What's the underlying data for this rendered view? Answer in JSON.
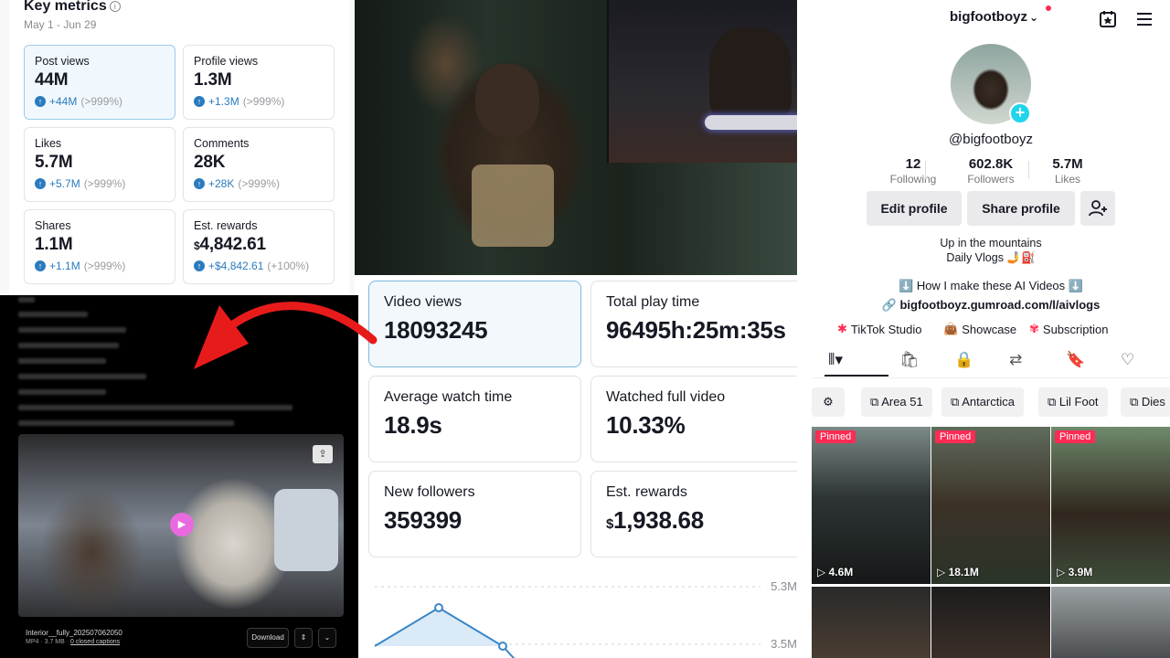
{
  "key_metrics": {
    "title": "Key metrics",
    "info_icon": "info-icon",
    "date_range": "May 1 - Jun 29",
    "cards": [
      {
        "label": "Post views",
        "value": "44M",
        "delta": "+44M",
        "pct": "(>999%)",
        "active": true
      },
      {
        "label": "Profile views",
        "value": "1.3M",
        "delta": "+1.3M",
        "pct": "(>999%)"
      },
      {
        "label": "Likes",
        "value": "5.7M",
        "delta": "+5.7M",
        "pct": "(>999%)"
      },
      {
        "label": "Comments",
        "value": "28K",
        "delta": "+28K",
        "pct": "(>999%)"
      },
      {
        "label": "Shares",
        "value": "1.1M",
        "delta": "+1.1M",
        "pct": "(>999%)"
      },
      {
        "label": "Est. rewards",
        "currency": "$",
        "value": "4,842.61",
        "delta": "+$4,842.61",
        "pct": "(+100%)"
      }
    ]
  },
  "download_panel": {
    "file_name": "Interior__fully_202507062050",
    "file_meta": "MP4 · 3.7 MB · ",
    "captions_link": "0 closed captions",
    "download_label": "Download",
    "accent_color": "#e96ae0"
  },
  "video_stats": {
    "cards": [
      {
        "label": "Video views",
        "value": "18093245",
        "active": true
      },
      {
        "label": "Total play time",
        "value": "96495h:25m:35s"
      },
      {
        "label": "Average watch time",
        "value": "18.9s"
      },
      {
        "label": "Watched full video",
        "value": "10.33%"
      },
      {
        "label": "New followers",
        "value": "359399"
      },
      {
        "label": "Est. rewards",
        "currency": "$",
        "value": "1,938.68"
      }
    ],
    "chart_ticks": [
      "5.3M",
      "3.5M"
    ]
  },
  "profile": {
    "username": "bigfootboyz",
    "handle": "@bigfootboyz",
    "stats": [
      {
        "value": "12",
        "label": "Following"
      },
      {
        "value": "602.8K",
        "label": "Followers"
      },
      {
        "value": "5.7M",
        "label": "Likes"
      }
    ],
    "edit_profile": "Edit profile",
    "share_profile": "Share profile",
    "bio_line1": "Up in the mountains",
    "bio_line2": "Daily Vlogs 🤳⛽",
    "bio_line3": "⬇️ How I make these AI Videos ⬇️",
    "link": "bigfootboyz.gumroad.com/l/aivlogs",
    "tools": [
      "TikTok Studio",
      "Showcase",
      "Subscription"
    ],
    "collections": [
      "Area 51",
      "Antarctica",
      "Lil Foot",
      "Dies"
    ],
    "pinned_label": "Pinned",
    "videos": [
      {
        "views": "4.6M",
        "pinned": true
      },
      {
        "views": "18.1M",
        "pinned": true
      },
      {
        "views": "3.9M",
        "pinned": true
      },
      {
        "views": ""
      },
      {
        "views": ""
      },
      {
        "views": ""
      }
    ],
    "brand_color": "#fe2c55",
    "accent_color": "#20d5ec"
  }
}
